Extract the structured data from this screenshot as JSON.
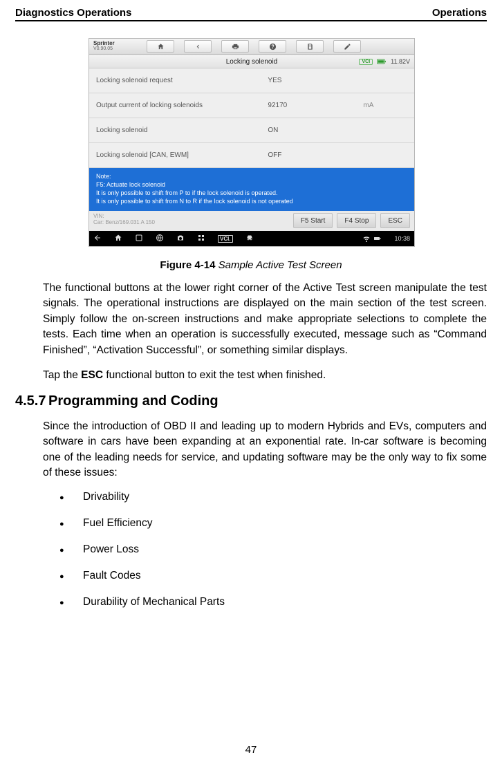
{
  "header": {
    "left": "Diagnostics Operations",
    "right": "Operations"
  },
  "figure": {
    "brand_line1": "Sprinter",
    "brand_line2": "V0.90.05",
    "title": "Locking solenoid",
    "vci": "VCI",
    "voltage": "11.82V",
    "rows": [
      {
        "label": "Locking solenoid request",
        "value": "YES",
        "unit": ""
      },
      {
        "label": "Output current of locking solenoids",
        "value": "92170",
        "unit": "mA"
      },
      {
        "label": "Locking solenoid",
        "value": "ON",
        "unit": ""
      },
      {
        "label": "Locking solenoid [CAN, EWM]",
        "value": "OFF",
        "unit": ""
      }
    ],
    "note_title": "Note:",
    "note_line1": "F5: Actuate lock solenoid",
    "note_line2": "It is only possible to shift from P to if the lock solenoid is operated.",
    "note_line3": "It is only possible to shift from N to R if the lock solenoid is not operated",
    "vin_label": "VIN:",
    "vin_car": "Car: Benz/169.031 A 150",
    "btn_start": "F5 Start",
    "btn_stop": "F4 Stop",
    "btn_esc": "ESC",
    "clock": "10:38"
  },
  "caption_bold": "Figure 4-14",
  "caption_italic": " Sample Active Test Screen",
  "para1": "The functional buttons at the lower right corner of the Active Test screen manipulate the test signals. The operational instructions are displayed on the main section of the test screen. Simply follow the on-screen instructions and make appropriate selections to complete the tests. Each time when an operation is successfully executed, message such as “Command Finished”, “Activation Successful”, or something similar displays.",
  "para2_pre": "Tap the ",
  "para2_bold": "ESC",
  "para2_post": " functional button to exit the test when finished.",
  "section_num": "4.5.7",
  "section_title": "Programming and Coding",
  "para3": "Since the introduction of OBD II and leading up to modern Hybrids and EVs, computers and software in cars have been expanding at an exponential rate. In-car software is becoming one of the leading needs for service, and updating software may be the only way to fix some of these issues:",
  "bullets": [
    "Drivability",
    "Fuel Efficiency",
    "Power Loss",
    "Fault Codes",
    "Durability of Mechanical Parts"
  ],
  "page_number": "47"
}
